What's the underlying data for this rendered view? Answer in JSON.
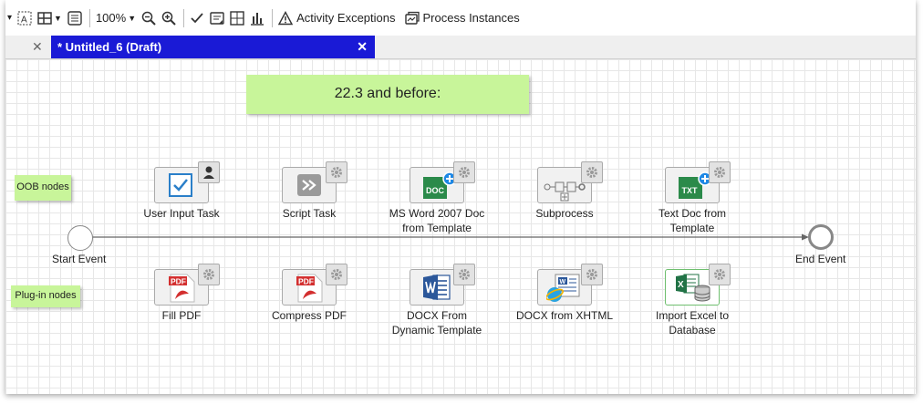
{
  "toolbar": {
    "zoom": "100%",
    "activity_exceptions": "Activity Exceptions",
    "process_instances": "Process Instances"
  },
  "tabs": {
    "active_title": "* Untitled_6 (Draft)",
    "close_glyph": "✕"
  },
  "notes": {
    "title": "22.3 and before:",
    "oob": "OOB nodes",
    "plugin": "Plug-in nodes"
  },
  "events": {
    "start": "Start Event",
    "end": "End Event"
  },
  "oob_nodes": [
    {
      "line1": "User Input Task",
      "line2": "",
      "icon": "user-input-checkbox-icon"
    },
    {
      "line1": "Script Task",
      "line2": "",
      "icon": "script-task-icon"
    },
    {
      "line1": "MS Word 2007 Doc",
      "line2": "from Template",
      "icon": "doc-plus-icon"
    },
    {
      "line1": "Subprocess",
      "line2": "",
      "icon": "subprocess-icon"
    },
    {
      "line1": "Text Doc from",
      "line2": "Template",
      "icon": "txt-plus-icon"
    }
  ],
  "plugin_nodes": [
    {
      "line1": "Fill PDF",
      "line2": "",
      "icon": "pdf-icon"
    },
    {
      "line1": "Compress PDF",
      "line2": "",
      "icon": "pdf-icon"
    },
    {
      "line1": "DOCX From",
      "line2": "Dynamic Template",
      "icon": "word-icon"
    },
    {
      "line1": "DOCX from XHTML",
      "line2": "",
      "icon": "word-web-icon"
    },
    {
      "line1": "Import Excel to",
      "line2": "Database",
      "icon": "excel-database-icon"
    }
  ],
  "icon_text": {
    "doc": "DOC",
    "txt": "TXT",
    "pdf": "PDF"
  },
  "colors": {
    "tab_active": "#1a1ad6",
    "note_green": "#c8f59a"
  }
}
